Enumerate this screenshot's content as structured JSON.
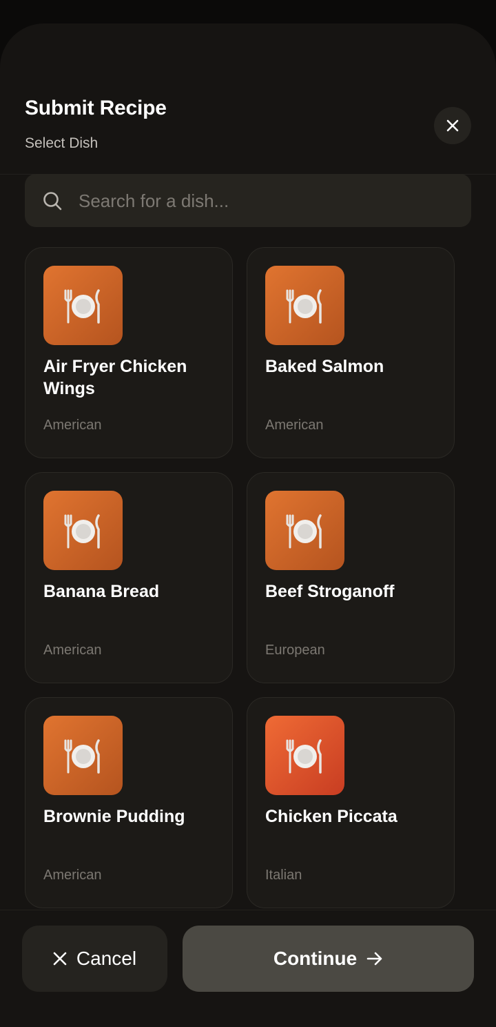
{
  "header": {
    "title": "Submit Recipe",
    "subtitle": "Select Dish"
  },
  "search": {
    "placeholder": "Search for a dish..."
  },
  "dishes": [
    {
      "name": "Air Fryer Chicken Wings",
      "cuisine": "American",
      "icon": "plate-with-cutlery-icon"
    },
    {
      "name": "Baked Salmon",
      "cuisine": "American",
      "icon": "plate-with-cutlery-icon"
    },
    {
      "name": "Banana Bread",
      "cuisine": "American",
      "icon": "plate-with-cutlery-icon"
    },
    {
      "name": "Beef Stroganoff",
      "cuisine": "European",
      "icon": "plate-with-cutlery-icon"
    },
    {
      "name": "Brownie Pudding",
      "cuisine": "American",
      "icon": "plate-with-cutlery-icon"
    },
    {
      "name": "Chicken Piccata",
      "cuisine": "Italian",
      "icon": "plate-with-cutlery-icon"
    }
  ],
  "footer": {
    "cancel_label": "Cancel",
    "continue_label": "Continue"
  },
  "colors": {
    "background": "#0b0a09",
    "sheet": "#161412",
    "card": "#1c1a17",
    "accent_orange": "#e07430",
    "accent_red": "#c83d22",
    "continue_button": "#4b4943"
  }
}
